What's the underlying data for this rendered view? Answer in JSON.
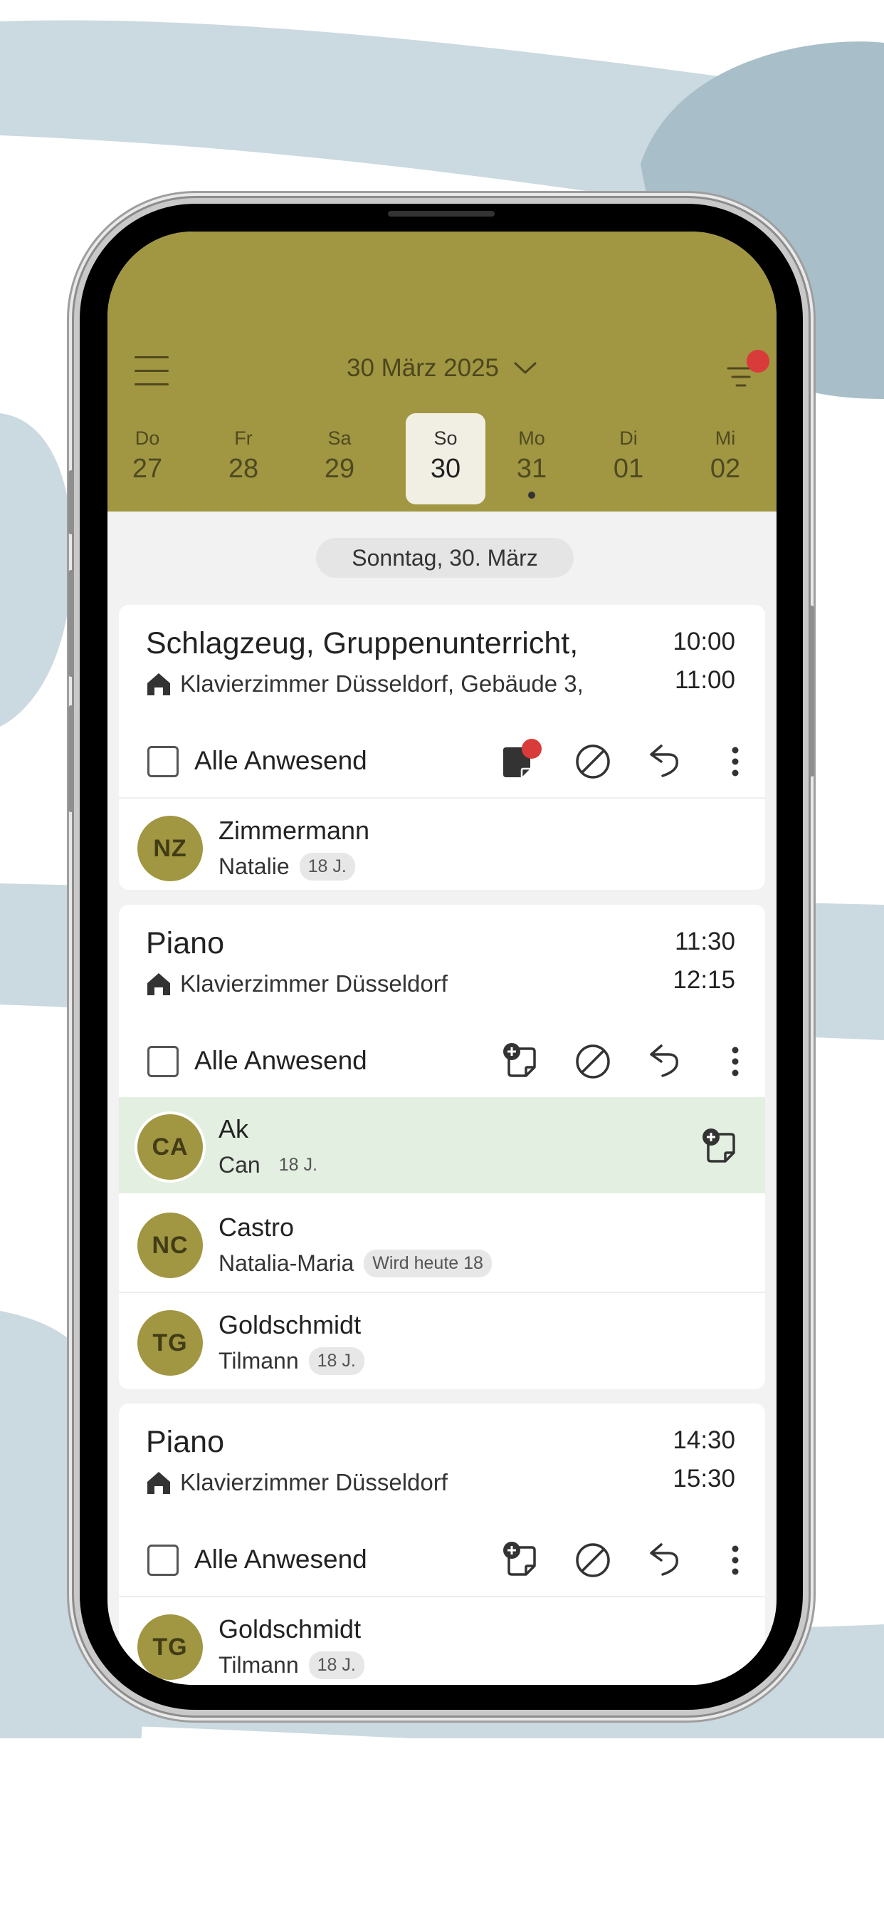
{
  "header": {
    "month_label": "30 März 2025",
    "color": "#a19642"
  },
  "week": [
    {
      "name": "Do",
      "date": "27",
      "selected": false,
      "has_event": false
    },
    {
      "name": "Fr",
      "date": "28",
      "selected": false,
      "has_event": false
    },
    {
      "name": "Sa",
      "date": "29",
      "selected": false,
      "has_event": false
    },
    {
      "name": "So",
      "date": "30",
      "selected": true,
      "has_event": false
    },
    {
      "name": "Mo",
      "date": "31",
      "selected": false,
      "has_event": true
    },
    {
      "name": "Di",
      "date": "01",
      "selected": false,
      "has_event": false
    },
    {
      "name": "Mi",
      "date": "02",
      "selected": false,
      "has_event": false
    }
  ],
  "day_heading": "Sonntag, 30. März",
  "lessons": [
    {
      "title": "Schlagzeug, Gruppenunterricht,",
      "room": "Klavierzimmer Düsseldorf, Gebäude 3,",
      "start": "10:00",
      "end": "11:00",
      "all_present_label": "Alle Anwesend",
      "students": [
        {
          "initials": "NZ",
          "last": "Zimmermann",
          "first": "Natalie",
          "badge": "18 J."
        }
      ]
    },
    {
      "title": "Piano",
      "room": "Klavierzimmer Düsseldorf",
      "start": "11:30",
      "end": "12:15",
      "all_present_label": "Alle Anwesend",
      "students": [
        {
          "initials": "CA",
          "last": "Ak",
          "first": "Can",
          "badge": "18 J."
        },
        {
          "initials": "NC",
          "last": "Castro",
          "first": "Natalia-Maria",
          "badge": "Wird heute 18"
        },
        {
          "initials": "TG",
          "last": "Goldschmidt",
          "first": "Tilmann",
          "badge": "18 J."
        }
      ]
    },
    {
      "title": "Piano",
      "room": "Klavierzimmer Düsseldorf",
      "start": "14:30",
      "end": "15:30",
      "all_present_label": "Alle Anwesend",
      "students": [
        {
          "initials": "TG",
          "last": "Goldschmidt",
          "first": "Tilmann",
          "badge": "18 J."
        }
      ]
    }
  ],
  "colors": {
    "accent": "#a19642",
    "notification": "#d93a3a",
    "highlight_row": "#e3efe1"
  }
}
